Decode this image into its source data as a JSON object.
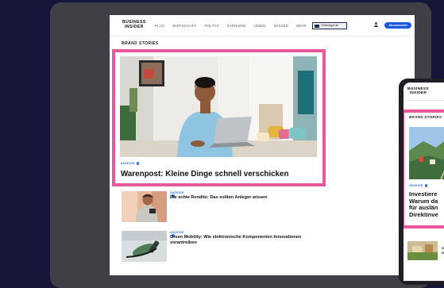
{
  "site": {
    "logo_line1": "BUSINESS",
    "logo_line2": "INSIDER"
  },
  "nav": [
    "PLUS",
    "WIRTSCHAFT",
    "POLITIK",
    "KARRIERE",
    "LEBEN",
    "WISSEN",
    "BBVR"
  ],
  "header": {
    "partner_badge": "Gütesiegel.de",
    "subscribe_label": "Abonnement"
  },
  "section_label": "BRAND STORIES",
  "featured": {
    "tag": "ANZEIGE",
    "title": "Warenpost: Kleine Dinge schnell verschicken"
  },
  "articles": [
    {
      "tag": "ANZEIGE",
      "title": "Die echte Rendite: Das sollten Anleger wissen"
    },
    {
      "tag": "ANZEIGE",
      "title": "Green Mobility: Wie elektronische Komponenten Innovationen vorantreiben"
    }
  ],
  "mobile": {
    "logo_line1": "BUSINESS",
    "logo_line2": "INSIDER",
    "section_label": "BRAND STORIES",
    "tag": "ANZEIGE",
    "title_lines": [
      "Investiere",
      "Warum da",
      "für auslän",
      "Direktinve"
    ],
    "small_lines": [
      "D",
      "N"
    ]
  },
  "colors": {
    "background": "#17163a",
    "highlight": "#e9589d",
    "accent": "#1b58e4",
    "device": "#3f3f45"
  }
}
